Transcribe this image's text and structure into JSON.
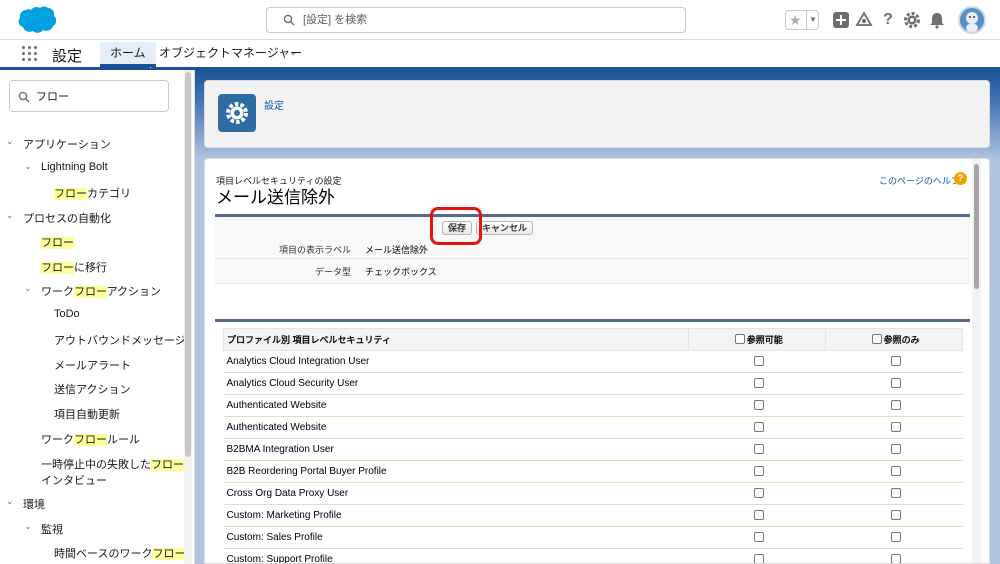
{
  "header": {
    "search_placeholder": "[設定] を検索"
  },
  "nav": {
    "app_name": "設定",
    "tabs": [
      {
        "label": "ホーム"
      },
      {
        "label": "オブジェクトマネージャー"
      }
    ]
  },
  "sidebar": {
    "search_value": "フロー",
    "items": [
      {
        "pre": "",
        "hl": "",
        "post": "アプリケーション"
      },
      {
        "pre": "",
        "hl": "",
        "post": "Lightning Bolt"
      },
      {
        "pre": "",
        "hl": "フロー",
        "post": "カテゴリ"
      },
      {
        "pre": "",
        "hl": "",
        "post": "プロセスの自動化"
      },
      {
        "pre": "",
        "hl": "フロー",
        "post": ""
      },
      {
        "pre": "",
        "hl": "フロー",
        "post": "に移行"
      },
      {
        "pre": "ワーク",
        "hl": "フロー",
        "post": "アクション"
      },
      {
        "pre": "",
        "hl": "",
        "post": "ToDo"
      },
      {
        "pre": "",
        "hl": "",
        "post": "アウトバウンドメッセージ"
      },
      {
        "pre": "",
        "hl": "",
        "post": "メールアラート"
      },
      {
        "pre": "",
        "hl": "",
        "post": "送信アクション"
      },
      {
        "pre": "",
        "hl": "",
        "post": "項目自動更新"
      },
      {
        "pre": "ワーク",
        "hl": "フロー",
        "post": "ルール"
      },
      {
        "pre": "一時停止中の失敗した",
        "hl": "フロー",
        "post": ""
      },
      {
        "pre": "インタビュー",
        "hl": "",
        "post": ""
      },
      {
        "pre": "",
        "hl": "",
        "post": "環境"
      },
      {
        "pre": "",
        "hl": "",
        "post": "監視"
      },
      {
        "pre": "時間ベースのワーク",
        "hl": "フロー",
        "post": ""
      }
    ]
  },
  "setup_header": {
    "link": "設定"
  },
  "page": {
    "kicker": "項目レベルセキュリティの設定",
    "title": "メール送信除外",
    "help_link": "このページのヘルプ",
    "help_icon": "?",
    "save_label": "保存",
    "cancel_label": "キャンセル",
    "fields": [
      {
        "label": "項目の表示ラベル",
        "value": "メール送信除外"
      },
      {
        "label": "データ型",
        "value": "チェックボックス"
      }
    ]
  },
  "perm_table": {
    "headers": [
      "プロファイル別 項目レベルセキュリティ",
      "参照可能",
      "参照のみ"
    ],
    "rows": [
      "Analytics Cloud Integration User",
      "Analytics Cloud Security User",
      "Authenticated Website",
      "Authenticated Website",
      "B2BMA Integration User",
      "B2B Reordering Portal Buyer Profile",
      "Cross Org Data Proxy User",
      "Custom: Marketing Profile",
      "Custom: Sales Profile",
      "Custom: Support Profile"
    ]
  },
  "colors": {
    "brand_blue": "#1b5297",
    "highlight_yellow": "#ffff99",
    "annotation_red": "#e8110b"
  }
}
